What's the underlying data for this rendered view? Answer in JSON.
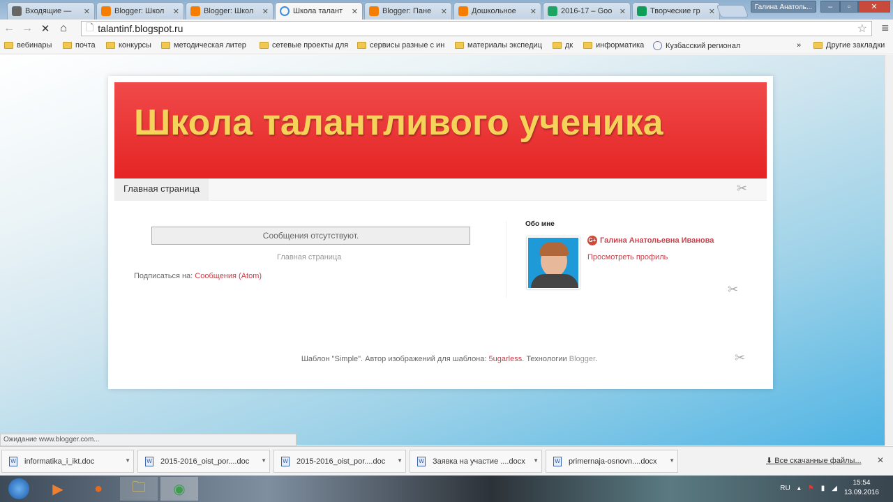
{
  "tabs": [
    {
      "label": "Входящие — ",
      "icon": "mail-icon",
      "color": "#666"
    },
    {
      "label": "Blogger: Школ",
      "icon": "blogger-icon",
      "color": "#f57d00"
    },
    {
      "label": "Blogger: Школ",
      "icon": "blogger-icon",
      "color": "#f57d00"
    },
    {
      "label": "Школа талант",
      "icon": "loading-icon",
      "color": "#3b8de0",
      "active": true
    },
    {
      "label": "Blogger: Пане",
      "icon": "blogger-icon",
      "color": "#f57d00"
    },
    {
      "label": "Дошкольное ",
      "icon": "blogger-icon",
      "color": "#f57d00"
    },
    {
      "label": "2016-17 – Goo",
      "icon": "drive-icon",
      "color": "#1fa463"
    },
    {
      "label": "Творческие гр",
      "icon": "sheets-icon",
      "color": "#0f9d58"
    }
  ],
  "profile_name": "Галина Анатоль...",
  "url": "talantinf.blogspot.ru",
  "bookmarks": [
    "вебинары",
    "почта",
    "конкурсы",
    "методическая литер",
    "сетевые проекты для",
    "сервисы разные с ин",
    "материалы экспедиц",
    "дк",
    "информатика",
    "Кузбасский регионал"
  ],
  "other_bookmarks": "Другие закладки",
  "blog": {
    "title": "Школа талантливого ученика",
    "home_tab": "Главная страница",
    "no_posts": "Сообщения отсутствуют.",
    "home_link": "Главная страница",
    "subscribe_label": "Подписаться на:",
    "subscribe_link": "Сообщения (Atom)",
    "about_title": "Обо мне",
    "author_name": "Галина Анатольевна Иванова",
    "view_profile": "Просмотреть профиль",
    "footer_prefix": "Шаблон \"Simple\". Автор изображений для шаблона:",
    "footer_author": "5ugarless",
    "footer_mid": ". Технологии",
    "footer_blogger": "Blogger",
    "footer_end": "."
  },
  "status": "Ожидание www.blogger.com...",
  "downloads": [
    "informatika_i_ikt.doc",
    "2015-2016_oist_por....doc",
    "2015-2016_oist_por....doc",
    "Заявка на участие ....docx",
    "primernaja-osnovn....docx"
  ],
  "all_downloads": "Все скачанные файлы...",
  "tray": {
    "lang": "RU",
    "time": "15:54",
    "date": "13.09.2016"
  }
}
